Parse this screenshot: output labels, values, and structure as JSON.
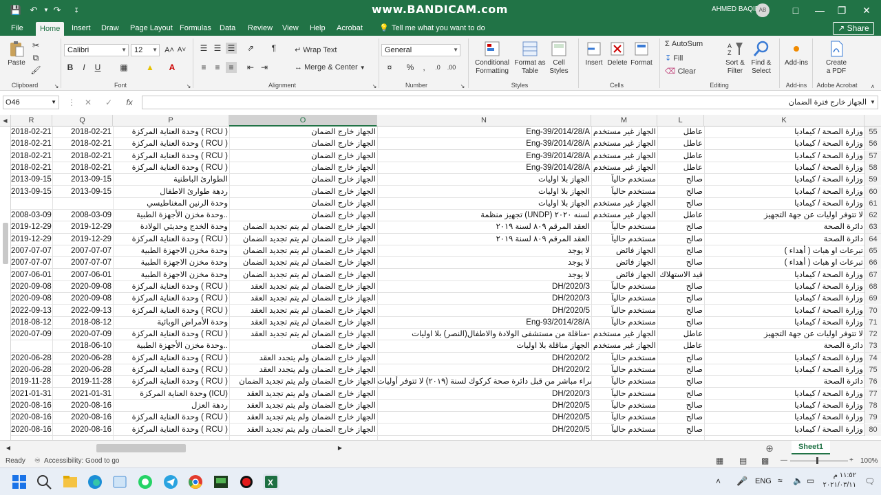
{
  "titlebar": {
    "watermark": "www.BANDICAM.com",
    "user_name": "AHMED BAQIR",
    "user_initials": "AB"
  },
  "tabs": [
    "File",
    "Home",
    "Insert",
    "Draw",
    "Page Layout",
    "Formulas",
    "Data",
    "Review",
    "View",
    "Help",
    "Acrobat"
  ],
  "tell_me": "Tell me what you want to do",
  "share_label": "Share",
  "ribbon": {
    "clipboard": {
      "paste": "Paste",
      "label": "Clipboard"
    },
    "font": {
      "name": "Calibri",
      "size": "12",
      "label": "Font"
    },
    "alignment": {
      "wrap_text": "Wrap Text",
      "merge_center": "Merge & Center",
      "label": "Alignment"
    },
    "number": {
      "format": "General",
      "label": "Number"
    },
    "styles": {
      "conditional": "Conditional",
      "conditional2": "Formatting",
      "format_as": "Format as",
      "format_as2": "Table",
      "cell_styles": "Cell",
      "cell_styles2": "Styles",
      "label": "Styles"
    },
    "cells": {
      "insert": "Insert",
      "delete": "Delete",
      "format": "Format",
      "label": "Cells"
    },
    "editing": {
      "autosum": "AutoSum",
      "fill": "Fill",
      "clear": "Clear",
      "sort": "Sort &",
      "sort2": "Filter",
      "find": "Find &",
      "find2": "Select",
      "label": "Editing"
    },
    "addins": {
      "addins": "Add-ins",
      "label": "Add-ins"
    },
    "acrobat": {
      "create": "Create",
      "create2": "a PDF",
      "label": "Adobe Acrobat"
    }
  },
  "formula_bar": {
    "name_box": "O46",
    "content": "الجهاز خارج فترة الضمان"
  },
  "columns": [
    "R",
    "Q",
    "P",
    "O",
    "N",
    "M",
    "L",
    "K"
  ],
  "rows": [
    {
      "num": "55",
      "R": "2018-02-21",
      "Q": "2018-02-21",
      "P": "وحدة العناية المركزة ( RCU )",
      "O": "الجهاز خارج الضمان",
      "N": "Eng-39/2014/28/A",
      "M": "الجهاز غير مستخدم",
      "L": "عاطل",
      "K": "وزارة الصحة / كيماديا"
    },
    {
      "num": "56",
      "R": "2018-02-21",
      "Q": "2018-02-21",
      "P": "وحدة العناية المركزة ( RCU )",
      "O": "الجهاز خارج الضمان",
      "N": "Eng-39/2014/28/A",
      "M": "الجهاز غير مستخدم",
      "L": "عاطل",
      "K": "وزارة الصحة / كيماديا"
    },
    {
      "num": "57",
      "R": "2018-02-21",
      "Q": "2018-02-21",
      "P": "وحدة العناية المركزة ( RCU )",
      "O": "الجهاز خارج الضمان",
      "N": "Eng-39/2014/28/A",
      "M": "الجهاز غير مستخدم",
      "L": "عاطل",
      "K": "وزارة الصحة / كيماديا"
    },
    {
      "num": "58",
      "R": "2018-02-21",
      "Q": "2018-02-21",
      "P": "وحدة العناية المركزة ( RCU )",
      "O": "الجهاز خارج الضمان",
      "N": "Eng-39/2014/28/A",
      "M": "الجهاز غير مستخدم",
      "L": "عاطل",
      "K": "وزارة الصحة / كيماديا"
    },
    {
      "num": "59",
      "R": "2013-09-15",
      "Q": "2013-09-15",
      "P": "الطوارئ الباطنية",
      "O": "الجهاز خارج الضمان",
      "N": "الجهاز بلا اوليات",
      "M": "مستخدم حالياً",
      "L": "صالح",
      "K": "وزارة الصحة / كيماديا"
    },
    {
      "num": "60",
      "R": "2013-09-15",
      "Q": "2013-09-15",
      "P": "ردهة طوارئ الاطفال",
      "O": "الجهاز خارج الضمان",
      "N": "الجهاز بلا اوليات",
      "M": "مستخدم حالياً",
      "L": "صالح",
      "K": "وزارة الصحة / كيماديا"
    },
    {
      "num": "61",
      "R": "",
      "Q": "",
      "P": "وحدة الرنين المغناطيسي",
      "O": "الجهاز خارج الضمان",
      "N": "الجهاز بلا اوليات",
      "M": "الجهاز غير مستخدم",
      "L": "صالح",
      "K": "وزارة الصحة / كيماديا"
    },
    {
      "num": "62",
      "R": "2008-03-09",
      "Q": "2008-03-09",
      "P": "وحدة مخزن الأجهزة الطبية..",
      "O": "الجهاز خارج الضمان",
      "N": "تجهيز منظمة (UNDP) لسنه ٢٠٢٠",
      "M": "الجهاز غير مستخدم",
      "L": "عاطل",
      "K": "لا تتوفر اوليات عن جهة التجهيز"
    },
    {
      "num": "63",
      "R": "2019-12-29",
      "Q": "2019-12-29",
      "P": "وحدة الخدج وحديثي الولادة",
      "O": "الجهاز خارج الضمان لم يتم تجديد الضمان",
      "N": "العقد المرقم ٨٠٩ لسنة ٢٠١٩",
      "M": "مستخدم حالياً",
      "L": "صالح",
      "K": "دائرة الصحة"
    },
    {
      "num": "64",
      "R": "2019-12-29",
      "Q": "2019-12-29",
      "P": "وحدة العناية المركزة ( RCU )",
      "O": "الجهاز خارج الضمان لم يتم تجديد الضمان",
      "N": "العقد المرقم ٨٠٩ لسنة ٢٠١٩",
      "M": "مستخدم حالياً",
      "L": "صالح",
      "K": "دائرة الصحة"
    },
    {
      "num": "65",
      "R": "2007-07-07",
      "Q": "2007-07-07",
      "P": "وحدة مخزن الاجهزة الطبية",
      "O": "الجهاز خارج الضمان لم يتم تجديد الضمان",
      "N": "لا يوجد",
      "M": "الجهاز فائض",
      "L": "صالح",
      "K": "تبرعات او هبات ( أهداء )"
    },
    {
      "num": "66",
      "R": "2007-07-07",
      "Q": "2007-07-07",
      "P": "وحدة مخزن الاجهزة الطبية",
      "O": "الجهاز خارج الضمان لم يتم تجديد الضمان",
      "N": "لا يوجد",
      "M": "الجهاز فائض",
      "L": "صالح",
      "K": "تبرعات او هبات ( أهداء )"
    },
    {
      "num": "67",
      "R": "2007-06-01",
      "Q": "2007-06-01",
      "P": "وحدة مخزن الاجهزة الطبية",
      "O": "الجهاز خارج الضمان لم يتم تجديد الضمان",
      "N": "لا يوجد",
      "M": "الجهاز فائض",
      "L": "قيد الاستهلاك",
      "K": "وزارة الصحة / كيماديا"
    },
    {
      "num": "68",
      "R": "2020-09-08",
      "Q": "2020-09-08",
      "P": "وحدة العناية المركزة ( RCU )",
      "O": "الجهاز خارج الضمان لم يتم تجديد العقد",
      "N": "DH/2020/3",
      "M": "مستخدم حالياً",
      "L": "صالح",
      "K": "وزارة الصحة / كيماديا"
    },
    {
      "num": "69",
      "R": "2020-09-08",
      "Q": "2020-09-08",
      "P": "وحدة العناية المركزة ( RCU )",
      "O": "الجهاز خارج الضمان لم يتم تجديد العقد",
      "N": "DH/2020/3",
      "M": "مستخدم حالياً",
      "L": "صالح",
      "K": "وزارة الصحة / كيماديا"
    },
    {
      "num": "70",
      "R": "2022-09-13",
      "Q": "2022-09-13",
      "P": "وحدة العناية المركزة ( RCU )",
      "O": "الجهاز خارج الضمان لم يتم تجديد العقد",
      "N": "DH/2020/5",
      "M": "مستخدم حالياً",
      "L": "صالح",
      "K": "وزارة الصحة / كيماديا"
    },
    {
      "num": "71",
      "R": "2018-08-12",
      "Q": "2018-08-12",
      "P": "وحدة الأمراض الوبائية",
      "O": "الجهاز خارج الضمان لم يتم تجديد العقد",
      "N": "Eng-93/2014/28/A",
      "M": "مستخدم حالياً",
      "L": "صالح",
      "K": "وزارة الصحة / كيماديا"
    },
    {
      "num": "72",
      "R": "2020-07-09",
      "Q": "2020-07-09",
      "P": "وحدة العناية المركزة ( RCU )",
      "O": "الجهاز خارج الضمان لم يتم تجديد العقد",
      "N": "مناقلة من مستشفى الولادة والاطفال(النصر) بلا اوليات-",
      "M": "الجهاز غير مستخدم",
      "L": "عاطل",
      "K": "لا تتوفر اوليات عن جهة التجهيز"
    },
    {
      "num": "73",
      "R": "",
      "Q": "2018-06-10",
      "P": "وحدة مخزن الأجهزة الطبية..",
      "O": "الجهاز خارج الضمان",
      "N": "الجهاز مناقلة بلا اوليات",
      "M": "الجهاز غير مستخدم",
      "L": "عاطل",
      "K": "دائرة الصحة"
    },
    {
      "num": "74",
      "R": "2020-06-28",
      "Q": "2020-06-28",
      "P": "وحدة العناية المركزة ( RCU )",
      "O": "الجهاز خارج الضمان ولم يتجدد العقد",
      "N": "DH/2020/2",
      "M": "مستخدم حالياً",
      "L": "صالح",
      "K": "وزارة الصحة / كيماديا"
    },
    {
      "num": "75",
      "R": "2020-06-28",
      "Q": "2020-06-28",
      "P": "وحدة العناية المركزة ( RCU )",
      "O": "الجهاز خارج الضمان ولم يتجدد العقد",
      "N": "DH/2020/2",
      "M": "مستخدم حالياً",
      "L": "صالح",
      "K": "وزارة الصحة / كيماديا"
    },
    {
      "num": "76",
      "R": "2019-11-28",
      "Q": "2019-11-28",
      "P": "وحدة العناية المركزة ( RCU )",
      "O": "الجهاز خارج الضمان ولم يتم تجديد الضمان",
      "N": "شراء مباشر من قبل دائرة صحة كركوك لسنة (٢٠١٩) لا تتوفر أوليات",
      "M": "مستخدم حالياً",
      "L": "صالح",
      "K": "دائرة الصحة"
    },
    {
      "num": "77",
      "R": "2021-01-31",
      "Q": "2021-01-31",
      "P": "وحدة العناية المركزة (ICU)",
      "O": "الجهاز خارج الضمان ولم يتم تجديد العقد",
      "N": "DH/2020/3",
      "M": "مستخدم حالياً",
      "L": "صالح",
      "K": "وزارة الصحة / كيماديا"
    },
    {
      "num": "78",
      "R": "2020-08-16",
      "Q": "2020-08-16",
      "P": "ردهة العزل",
      "O": "الجهاز خارج الضمان ولم يتم تجديد العقد",
      "N": "DH/2020/5",
      "M": "مستخدم حالياً",
      "L": "صالح",
      "K": "وزارة الصحة / كيماديا"
    },
    {
      "num": "79",
      "R": "2020-08-16",
      "Q": "2020-08-16",
      "P": "وحدة العناية المركزة ( RCU )",
      "O": "الجهاز خارج الضمان ولم يتم تجديد العقد",
      "N": "DH/2020/5",
      "M": "مستخدم حالياً",
      "L": "صالح",
      "K": "وزارة الصحة / كيماديا"
    },
    {
      "num": "80",
      "R": "2020-08-16",
      "Q": "2020-08-16",
      "P": "وحدة العناية المركزة ( RCU )",
      "O": "الجهاز خارج الضمان ولم يتم تجديد العقد",
      "N": "DH/2020/5",
      "M": "مستخدم حالياً",
      "L": "صالح",
      "K": "وزارة الصحة / كيماديا"
    }
  ],
  "sheet_tab": "Sheet1",
  "status": {
    "ready": "Ready",
    "accessibility": "Accessibility: Good to go",
    "zoom": "100%"
  },
  "taskbar": {
    "lang": "ENG",
    "time": "١١:٥٢ م",
    "date": "٢٠٢١/٠٣/١١"
  }
}
